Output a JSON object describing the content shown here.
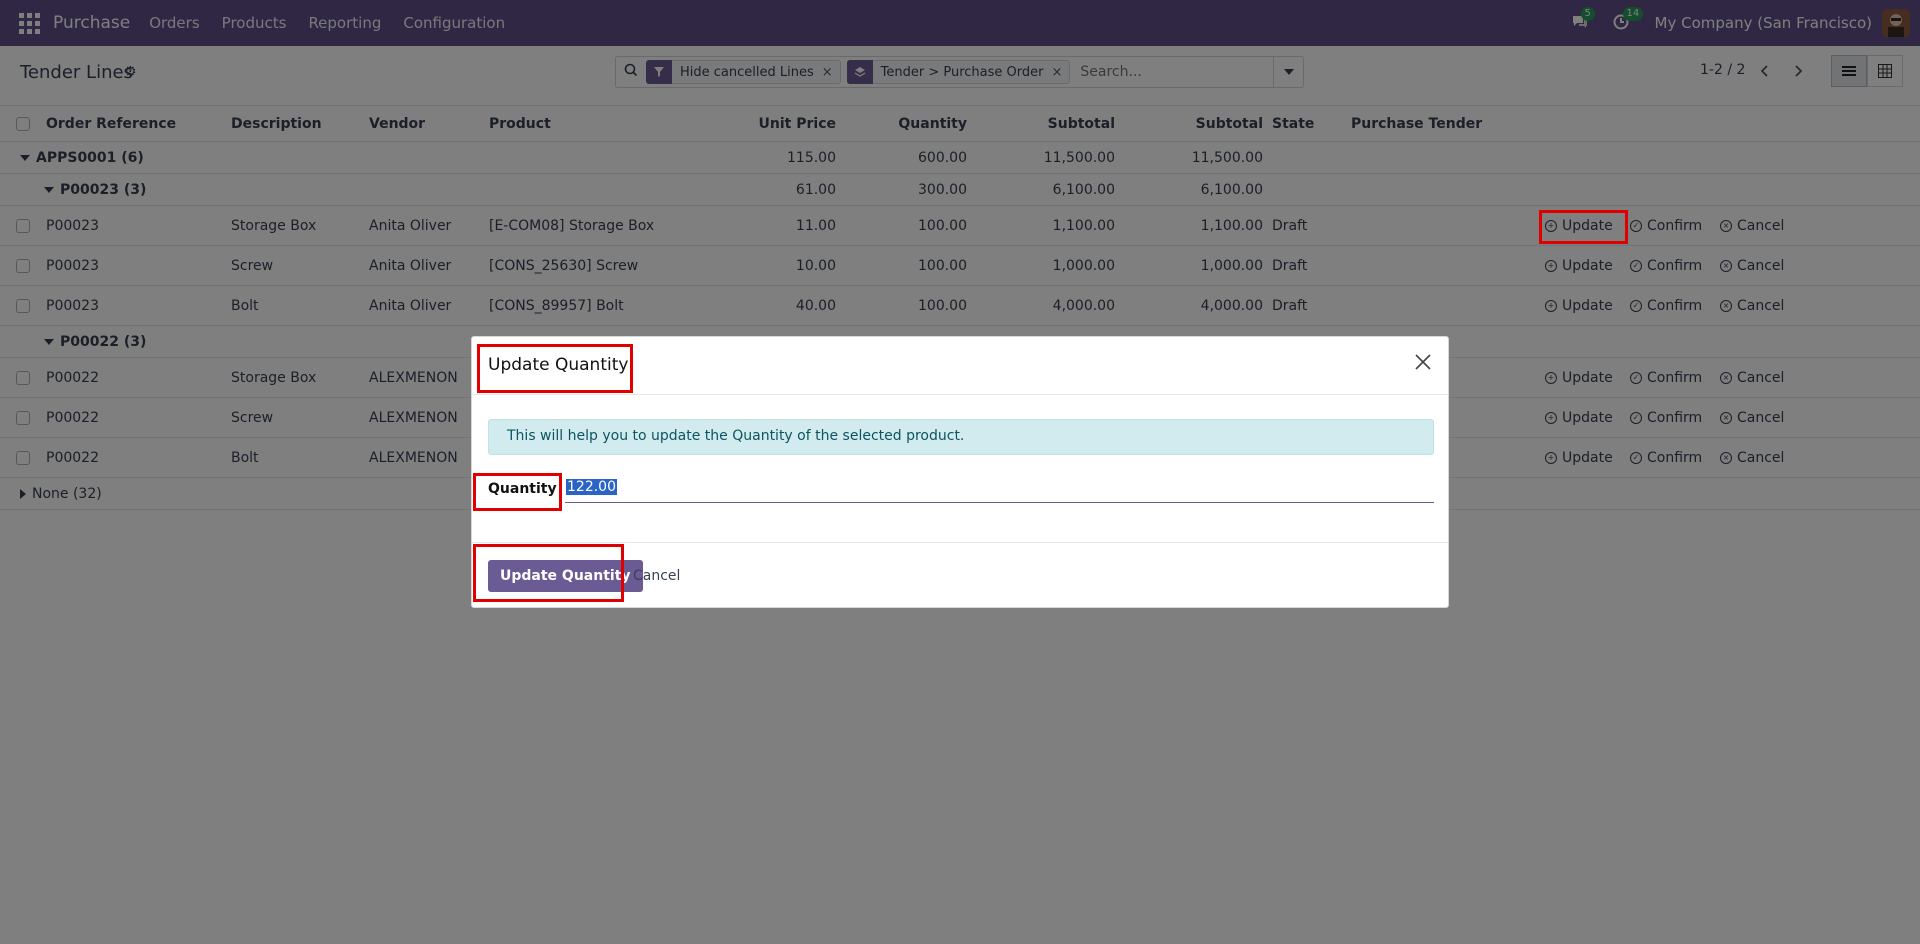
{
  "navbar": {
    "app_name": "Purchase",
    "menus": [
      "Orders",
      "Products",
      "Reporting",
      "Configuration"
    ],
    "messages_count": "5",
    "activities_count": "14",
    "company": "My Company (San Francisco)"
  },
  "control_panel": {
    "title": "Tender Lines",
    "facets": [
      {
        "label": "Hide cancelled Lines"
      },
      {
        "label": "Tender > Purchase Order"
      }
    ],
    "search_placeholder": "Search...",
    "pager": "1-2 / 2"
  },
  "table": {
    "headers": {
      "order_ref": "Order Reference",
      "description": "Description",
      "vendor": "Vendor",
      "product": "Product",
      "unit_price": "Unit Price",
      "quantity": "Quantity",
      "subtotal1": "Subtotal",
      "subtotal2": "Subtotal",
      "state": "State",
      "tender": "Purchase Tender"
    },
    "group_apps": {
      "label": "APPS0001 (6)",
      "unit_price": "115.00",
      "quantity": "600.00",
      "subtotal1": "11,500.00",
      "subtotal2": "11,500.00"
    },
    "group_p23": {
      "label": "P00023 (3)",
      "unit_price": "61.00",
      "quantity": "300.00",
      "subtotal1": "6,100.00",
      "subtotal2": "6,100.00"
    },
    "rows_p23": [
      {
        "ref": "P00023",
        "desc": "Storage Box",
        "vendor": "Anita Oliver",
        "product": "[E-COM08] Storage Box",
        "unit_price": "11.00",
        "quantity": "100.00",
        "subtotal1": "1,100.00",
        "subtotal2": "1,100.00",
        "state": "Draft"
      },
      {
        "ref": "P00023",
        "desc": "Screw",
        "vendor": "Anita Oliver",
        "product": "[CONS_25630] Screw",
        "unit_price": "10.00",
        "quantity": "100.00",
        "subtotal1": "1,000.00",
        "subtotal2": "1,000.00",
        "state": "Draft"
      },
      {
        "ref": "P00023",
        "desc": "Bolt",
        "vendor": "Anita Oliver",
        "product": "[CONS_89957] Bolt",
        "unit_price": "40.00",
        "quantity": "100.00",
        "subtotal1": "4,000.00",
        "subtotal2": "4,000.00",
        "state": "Draft"
      }
    ],
    "group_p22": {
      "label": "P00022 (3)"
    },
    "rows_p22": [
      {
        "ref": "P00022",
        "desc": "Storage Box",
        "vendor": "ALEXMENON"
      },
      {
        "ref": "P00022",
        "desc": "Screw",
        "vendor": "ALEXMENON"
      },
      {
        "ref": "P00022",
        "desc": "Bolt",
        "vendor": "ALEXMENON"
      }
    ],
    "group_none": {
      "label": "None (32)"
    },
    "actions": {
      "update": "Update",
      "confirm": "Confirm",
      "cancel": "Cancel"
    }
  },
  "modal": {
    "title": "Update Quantity",
    "alert": "This will help you to update the Quantity of the selected product.",
    "quantity_label": "Quantity",
    "quantity_value": "122.00",
    "primary_button": "Update Quantity",
    "cancel_button": "Cancel"
  },
  "colors": {
    "navbar": "#5e4f86",
    "primary": "#6b5b95",
    "highlight_box": "#e00000",
    "alert_bg": "#d2ebef"
  }
}
